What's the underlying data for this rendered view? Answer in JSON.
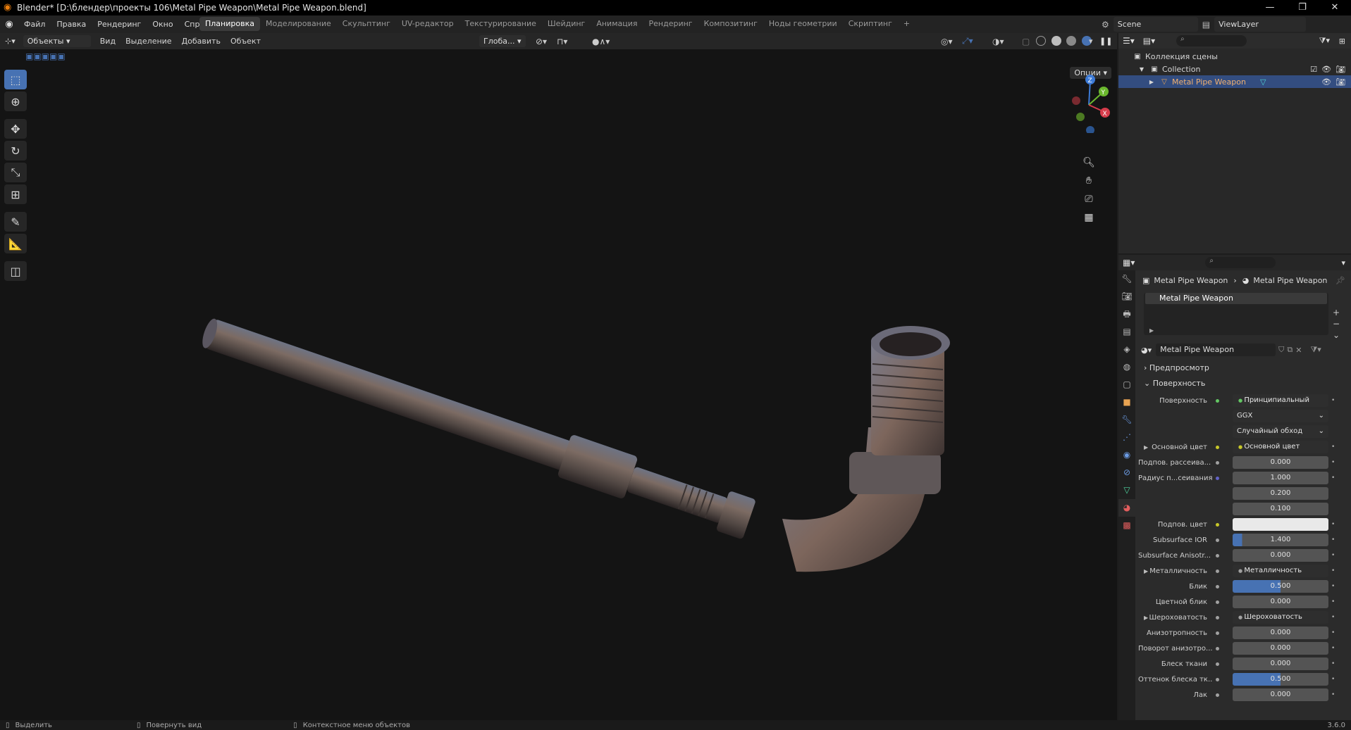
{
  "window": {
    "title": "Blender* [D:\\блендер\\проекты 106\\Metal Pipe Weapon\\Metal Pipe Weapon.blend]",
    "minimize": "—",
    "maximize": "❐",
    "close": "✕"
  },
  "menu": [
    "Файл",
    "Правка",
    "Рендеринг",
    "Окно",
    "Справка"
  ],
  "workspaces": [
    {
      "label": "Планировка",
      "active": true
    },
    {
      "label": "Моделирование",
      "active": false
    },
    {
      "label": "Скульптинг",
      "active": false
    },
    {
      "label": "UV-редактор",
      "active": false
    },
    {
      "label": "Текстурирование",
      "active": false
    },
    {
      "label": "Шейдинг",
      "active": false
    },
    {
      "label": "Анимация",
      "active": false
    },
    {
      "label": "Рендеринг",
      "active": false
    },
    {
      "label": "Композитинг",
      "active": false
    },
    {
      "label": "Ноды геометрии",
      "active": false
    },
    {
      "label": "Скриптинг",
      "active": false
    }
  ],
  "add_workspace": "+",
  "scene": {
    "name": "Scene",
    "view_layer": "ViewLayer"
  },
  "viewport": {
    "mode": "Объекты",
    "menus": [
      "Вид",
      "Выделение",
      "Добавить",
      "Объект"
    ],
    "transform_orientation": "Глоба...",
    "options": "Опции",
    "gizmo": {
      "z": "Z",
      "y": "Y",
      "x": "X"
    }
  },
  "outliner": {
    "root": "Коллекция сцены",
    "collection": "Collection",
    "object": "Metal Pipe Weapon"
  },
  "properties": {
    "breadcrumb_object": "Metal Pipe Weapon",
    "breadcrumb_material": "Metal Pipe Weapon",
    "slot": "Metal Pipe Weapon",
    "material_name": "Metal Pipe Weapon",
    "panel_preview": "Предпросмотр",
    "panel_surface": "Поверхность",
    "rows": [
      {
        "label": "Поверхность",
        "value": "Принципиальный BSDF",
        "kind": "link",
        "socket": "#63c763"
      },
      {
        "label": "",
        "value": "GGX",
        "kind": "drop",
        "socket": ""
      },
      {
        "label": "",
        "value": "Случайный обход",
        "kind": "drop",
        "socket": ""
      },
      {
        "label": "Основной цвет",
        "value": "Основной цвет",
        "kind": "link",
        "socket": "#c7c729",
        "expand": true
      },
      {
        "label": "Подпов. рассеива...",
        "value": "0.000",
        "kind": "num",
        "socket": "#a1a1a1"
      },
      {
        "label": "Радиус п...сеивания",
        "value": "1.000",
        "kind": "num",
        "socket": "#6363c7"
      },
      {
        "label": "",
        "value": "0.200",
        "kind": "num",
        "socket": ""
      },
      {
        "label": "",
        "value": "0.100",
        "kind": "num",
        "socket": ""
      },
      {
        "label": "Подпов. цвет",
        "value": "",
        "kind": "white",
        "socket": "#c7c729"
      },
      {
        "label": "Subsurface IOR",
        "value": "1.400",
        "kind": "num",
        "socket": "#a1a1a1",
        "fill": 0.1
      },
      {
        "label": "Subsurface Anisotr...",
        "value": "0.000",
        "kind": "num",
        "socket": "#a1a1a1"
      },
      {
        "label": "Металличность",
        "value": "Металличность",
        "kind": "link",
        "socket": "#a1a1a1",
        "expand": true
      },
      {
        "label": "Блик",
        "value": "0.500",
        "kind": "num",
        "socket": "#a1a1a1",
        "fill": 0.5
      },
      {
        "label": "Цветной блик",
        "value": "0.000",
        "kind": "num",
        "socket": "#a1a1a1"
      },
      {
        "label": "Шероховатость",
        "value": "Шероховатость",
        "kind": "link",
        "socket": "#a1a1a1",
        "expand": true
      },
      {
        "label": "Анизотропность",
        "value": "0.000",
        "kind": "num",
        "socket": "#a1a1a1"
      },
      {
        "label": "Поворот анизотро...",
        "value": "0.000",
        "kind": "num",
        "socket": "#a1a1a1"
      },
      {
        "label": "Блеск ткани",
        "value": "0.000",
        "kind": "num",
        "socket": "#a1a1a1"
      },
      {
        "label": "Оттенок блеска тк...",
        "value": "0.500",
        "kind": "num",
        "socket": "#a1a1a1",
        "fill": 0.5
      },
      {
        "label": "Лак",
        "value": "0.000",
        "kind": "num",
        "socket": "#a1a1a1"
      }
    ]
  },
  "statusbar": {
    "select": "Выделить",
    "rotate": "Повернуть вид",
    "context": "Контекстное меню объектов",
    "version": "3.6.0"
  },
  "colors": {
    "accent": "#4772b3",
    "selected_row": "#334d80",
    "blender_orange": "#e87d0d"
  }
}
